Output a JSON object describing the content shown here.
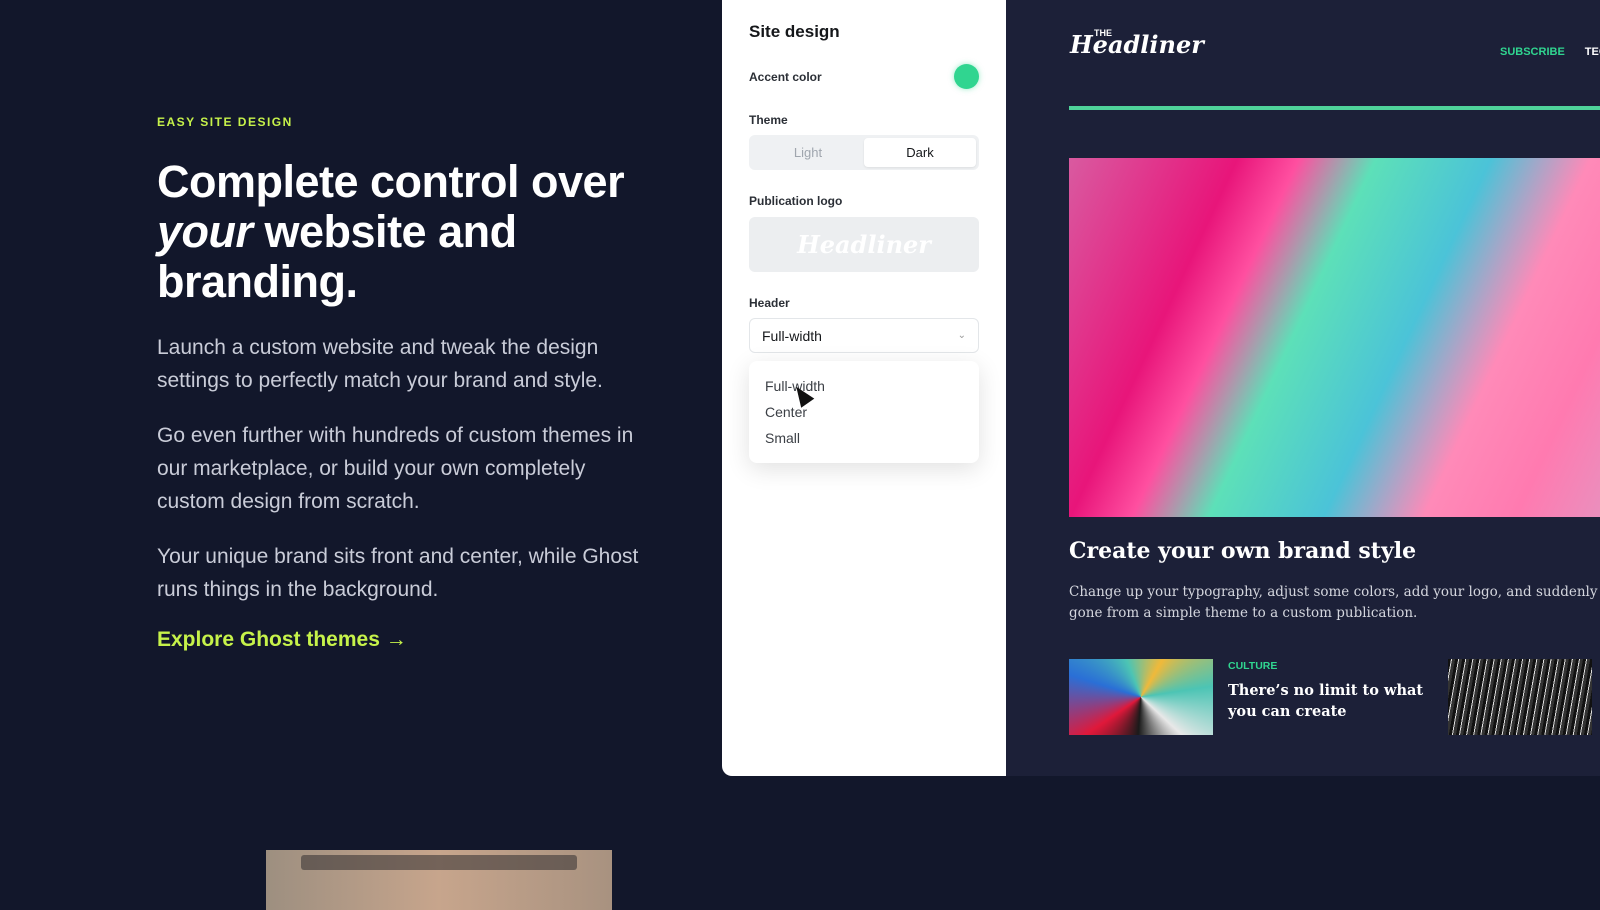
{
  "hero": {
    "eyebrow": "EASY SITE DESIGN",
    "headline_1": "Complete control over",
    "headline_em": "your",
    "headline_2": " website and branding.",
    "paragraphs": [
      "Launch a custom website and tweak the design settings to perfectly match your brand and style.",
      "Go even further with hundreds of custom themes in our marketplace, or build your own completely custom design from scratch.",
      "Your unique brand sits front and center, while Ghost runs things in the background."
    ],
    "cta": "Explore Ghost themes →",
    "accent": "#c6f24a"
  },
  "panel": {
    "title": "Site design",
    "accent_label": "Accent color",
    "accent_color": "#30d590",
    "theme_label": "Theme",
    "theme_options": [
      "Light",
      "Dark"
    ],
    "theme_selected": "Dark",
    "logo_label": "Publication logo",
    "logo_text": "THE Headliner",
    "header_label": "Header",
    "header_value": "Full-width",
    "header_options": [
      "Full-width",
      "Center",
      "Small"
    ]
  },
  "preview": {
    "logo_small": "THE",
    "logo": "Headliner",
    "nav": [
      "SUBSCRIBE",
      "TEC"
    ],
    "title": "Create your own brand style",
    "desc_1": "Change up your typography, adjust some colors, add your logo, and suddenly you",
    "desc_2": "gone from a simple theme to a custom publication.",
    "card": {
      "category": "CULTURE",
      "title": "There’s no limit to what you can create"
    }
  }
}
